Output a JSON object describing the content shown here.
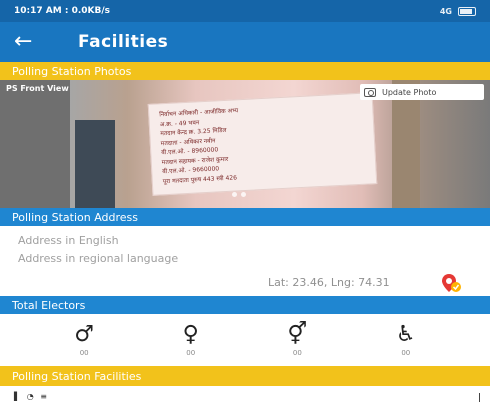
{
  "status_bar": {
    "time": "10:17 AM",
    "speed": "0.0KB/s",
    "time_speed": "10:17 AM : 0.0KB/s",
    "signal": "4G"
  },
  "app_bar": {
    "back_icon": "arrow-left-icon",
    "title": "Facilities"
  },
  "photos_section": {
    "header": "Polling Station Photos",
    "photo_label": "PS Front View",
    "update_photo_label": "Update Photo",
    "sign_lines": [
      "निर्वाचन अधिकारी - आजीविक अभ्य",
      "अ.क्र. - 49 भवन",
      "मतदान केन्द्र क्र. 3.25 मिडिल",
      "मतदाता - अधिकार नवीन",
      "बी.एल.ओ. - 8960000",
      "मतदान सहायक - राजेश कुमार",
      "बी.एल.ओ. - 9660000",
      "पूरा मतदाता पुरुष 443 स्त्री 426"
    ]
  },
  "address_section": {
    "header": "Polling Station Address",
    "address_english_placeholder": "Address in English",
    "address_regional_placeholder": "Address in regional language",
    "latlng": "Lat: 23.46, Lng: 74.31"
  },
  "electors_section": {
    "header": "Total Electors",
    "items": [
      {
        "icon": "male-elector-icon",
        "glyph": "♂",
        "count": "00"
      },
      {
        "icon": "female-elector-icon",
        "glyph": "♀",
        "count": "00"
      },
      {
        "icon": "third-gender-elector-icon",
        "glyph": "⚥",
        "count": "00"
      },
      {
        "icon": "pwd-elector-icon",
        "glyph": "♿",
        "count": "00"
      }
    ]
  },
  "facilities_section": {
    "header": "Polling Station Facilities"
  },
  "colors": {
    "status_bar": "#1565a8",
    "app_bar": "#1976c0",
    "yellow_header": "#f2c21b",
    "blue_header": "#1f86d1"
  }
}
